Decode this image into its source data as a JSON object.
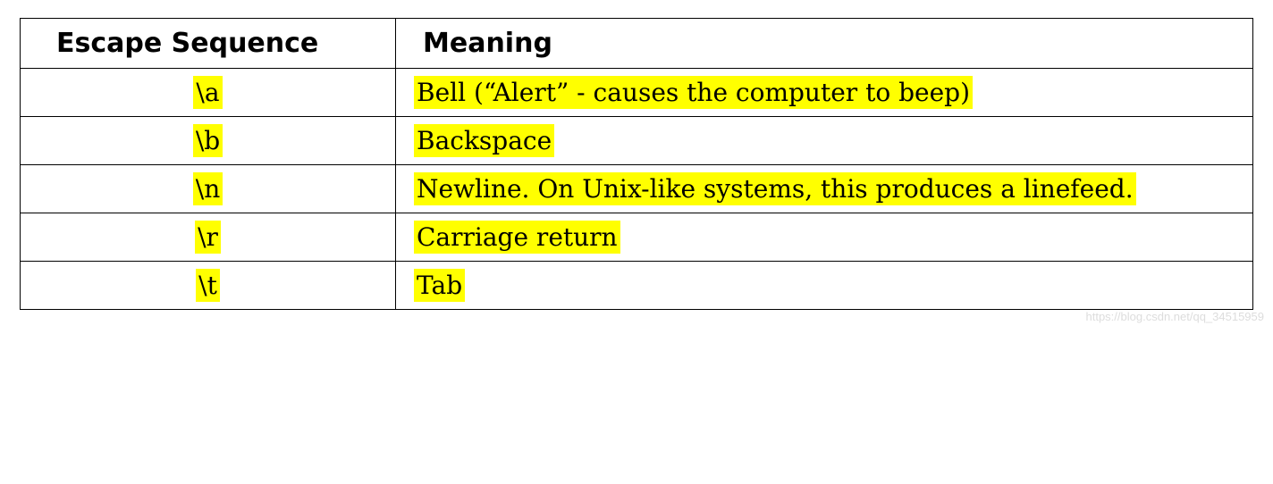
{
  "table": {
    "headers": {
      "col1": "Escape Sequence",
      "col2": "Meaning"
    },
    "rows": [
      {
        "escape": "\\a",
        "meaning": "Bell (“Alert” - causes the computer to beep)"
      },
      {
        "escape": "\\b",
        "meaning": "Backspace"
      },
      {
        "escape": "\\n",
        "meaning": "Newline.  On Unix-like systems, this produces a linefeed."
      },
      {
        "escape": "\\r",
        "meaning": "Carriage return"
      },
      {
        "escape": "\\t",
        "meaning": "Tab"
      }
    ]
  },
  "watermark": "https://blog.csdn.net/qq_34515959"
}
